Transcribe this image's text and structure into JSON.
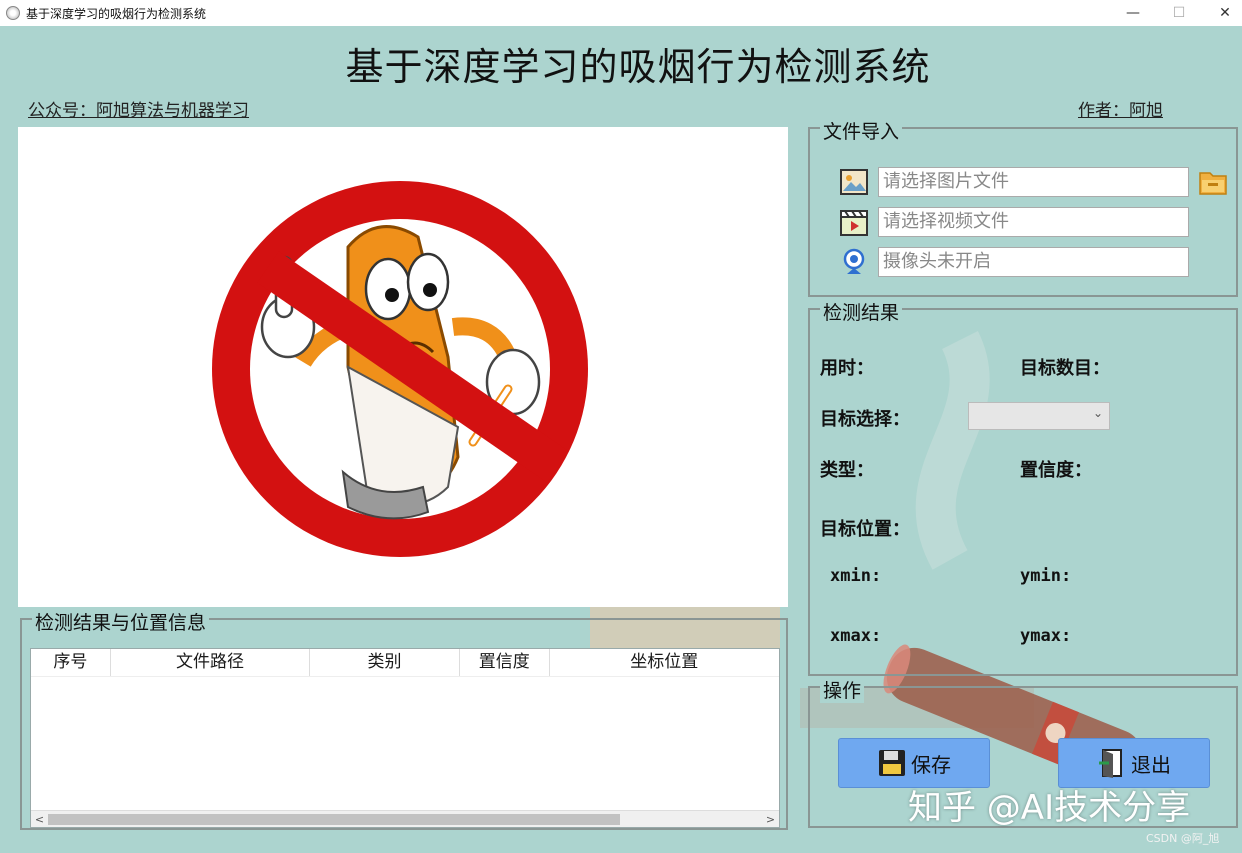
{
  "window": {
    "title": "基于深度学习的吸烟行为检测系统",
    "min": "—",
    "max": "☐",
    "close": "✕"
  },
  "header": {
    "title": "基于深度学习的吸烟行为检测系统",
    "left_caption": "公众号：阿旭算法与机器学习",
    "right_caption": "作者：阿旭"
  },
  "image_panel": {
    "icon": "no-smoking-illustration"
  },
  "results_table": {
    "group_title": "检测结果与位置信息",
    "columns": [
      "序号",
      "文件路径",
      "类别",
      "置信度",
      "坐标位置"
    ],
    "rows": [],
    "scroll_left": "<",
    "scroll_right": ">"
  },
  "file_import": {
    "group_title": "文件导入",
    "image_placeholder": "请选择图片文件",
    "video_placeholder": "请选择视频文件",
    "camera_placeholder": "摄像头未开启"
  },
  "detection": {
    "group_title": "检测结果",
    "time_label": "用时：",
    "count_label": "目标数目：",
    "select_label": "目标选择：",
    "select_value": "",
    "type_label": "类型：",
    "confidence_label": "置信度：",
    "position_label": "目标位置：",
    "xmin_label": "xmin:",
    "ymin_label": "ymin:",
    "xmax_label": "xmax:",
    "ymax_label": "ymax:"
  },
  "operations": {
    "group_title": "操作",
    "save_label": "保存",
    "exit_label": "退出"
  },
  "watermark": "知乎 @AI技术分享",
  "csdn_mark": "CSDN @阿_旭",
  "colors": {
    "background": "#acd4cf",
    "button": "#6fa8f0",
    "sign_red": "#d01010",
    "cigarette_orange": "#f0901a"
  }
}
